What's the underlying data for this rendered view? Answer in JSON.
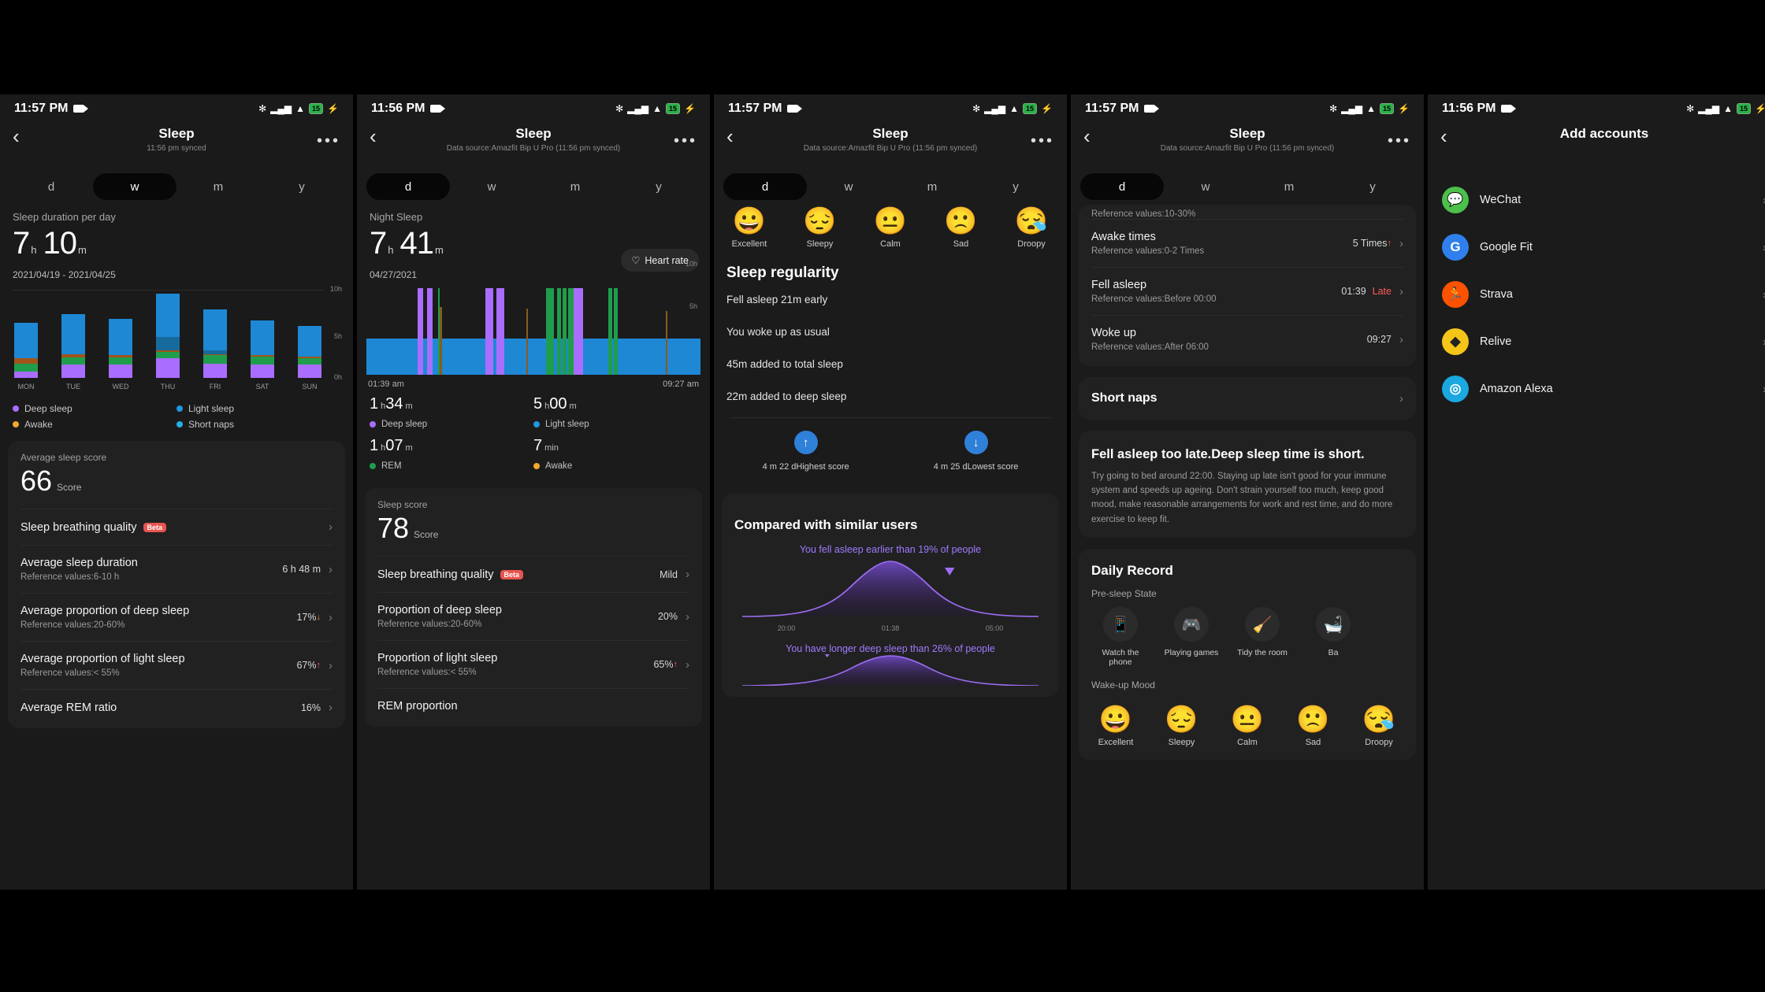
{
  "panels": {
    "p1": {
      "status": {
        "time": "11:57 PM",
        "battery": "15"
      },
      "header": {
        "title": "Sleep",
        "subtitle": "11:56 pm synced",
        "back": "‹",
        "menu": "•••"
      },
      "tabs": [
        {
          "label": "d",
          "active": false
        },
        {
          "label": "w",
          "active": true
        },
        {
          "label": "m",
          "active": false
        },
        {
          "label": "y",
          "active": false
        }
      ],
      "section_label": "Sleep duration per day",
      "value": {
        "hours": "7",
        "h_unit": "h",
        "minutes": "10",
        "m_unit": "m"
      },
      "range": "2021/04/19 - 2021/04/25",
      "y_ticks": [
        "10h",
        "5h",
        "0h"
      ],
      "legend": [
        {
          "label": "Deep sleep",
          "color": "#a96dff"
        },
        {
          "label": "Light sleep",
          "color": "#2196e3"
        },
        {
          "label": "Awake",
          "color": "#f0a92e"
        },
        {
          "label": "Short naps",
          "color": "#23b0e8"
        }
      ],
      "avg_score_label": "Average sleep score",
      "avg_score": "66",
      "score_unit": "Score",
      "rows": [
        {
          "title": "Sleep breathing quality",
          "badge": "Beta",
          "sub": "",
          "value": "",
          "arrow": ""
        },
        {
          "title": "Average sleep duration",
          "sub": "Reference values:6-10 h",
          "value": "6 h 48 m",
          "arrow": ""
        },
        {
          "title": "Average proportion of deep sleep",
          "sub": "Reference values:20-60%",
          "value": "17%",
          "arrow": "↓",
          "arrow_color": "#ff8a3d"
        },
        {
          "title": "Average proportion of light sleep",
          "sub": "Reference values:< 55%",
          "value": "67%",
          "arrow": "↑",
          "arrow_color": "#ff5a5a"
        },
        {
          "title": "Average REM ratio",
          "sub": "",
          "value": "16%",
          "arrow": "↑",
          "arrow_color": "#ff5a5a"
        }
      ]
    },
    "p2": {
      "status": {
        "time": "11:56 PM",
        "battery": "15"
      },
      "header": {
        "title": "Sleep",
        "subtitle": "Data source:Amazfit Bip U Pro (11:56 pm synced)",
        "back": "‹",
        "menu": "•••"
      },
      "tabs": [
        {
          "label": "d",
          "active": true
        },
        {
          "label": "w",
          "active": false
        },
        {
          "label": "m",
          "active": false
        },
        {
          "label": "y",
          "active": false
        }
      ],
      "section_label": "Night Sleep",
      "value": {
        "hours": "7",
        "h_unit": "h",
        "minutes": "41",
        "m_unit": "m"
      },
      "date": "04/27/2021",
      "heart_rate_btn": "Heart rate",
      "y_ticks": [
        "10h",
        "5h"
      ],
      "start_time": "01:39 am",
      "end_time": "09:27 am",
      "stats": [
        {
          "value": "1",
          "unit1": "h",
          "value2": "34",
          "unit2": "m",
          "label": "Deep sleep",
          "color": "#a96dff"
        },
        {
          "value": "5",
          "unit1": "h",
          "value2": "00",
          "unit2": "m",
          "label": "Light sleep",
          "color": "#2196e3"
        },
        {
          "value": "1",
          "unit1": "h",
          "value2": "07",
          "unit2": "m",
          "label": "REM",
          "color": "#1f9d4d"
        },
        {
          "value": "7",
          "unit1": "",
          "value2": "",
          "unit2": "min",
          "label": "Awake",
          "color": "#f0a92e"
        }
      ],
      "score_label": "Sleep score",
      "score": "78",
      "score_unit": "Score",
      "rows": [
        {
          "title": "Sleep breathing quality",
          "badge": "Beta",
          "sub": "",
          "value": "Mild"
        },
        {
          "title": "Proportion of deep sleep",
          "sub": "Reference values:20-60%",
          "value": "20%"
        },
        {
          "title": "Proportion of light sleep",
          "sub": "Reference values:< 55%",
          "value": "65%",
          "arrow": "↑",
          "arrow_color": "#ff5a5a"
        },
        {
          "title": "REM proportion",
          "sub": "",
          "value": ""
        }
      ]
    },
    "p3": {
      "status": {
        "time": "11:57 PM",
        "battery": "15"
      },
      "header": {
        "title": "Sleep",
        "subtitle": "Data source:Amazfit Bip U Pro (11:56 pm synced)",
        "back": "‹",
        "menu": "•••"
      },
      "tabs": [
        {
          "label": "d",
          "active": true
        },
        {
          "label": "w",
          "active": false
        },
        {
          "label": "m",
          "active": false
        },
        {
          "label": "y",
          "active": false
        }
      ],
      "moods": [
        {
          "emoji": "😀",
          "label": "Excellent"
        },
        {
          "emoji": "😔",
          "label": "Sleepy"
        },
        {
          "emoji": "😐",
          "label": "Calm"
        },
        {
          "emoji": "🙁",
          "label": "Sad"
        },
        {
          "emoji": "😪",
          "label": "Droopy"
        }
      ],
      "regularity_title": "Sleep regularity",
      "regularity_items": [
        "Fell asleep 21m early",
        "You woke up as usual",
        "45m added to total sleep",
        "22m added to deep sleep"
      ],
      "score_pair": [
        {
          "icon": "↑",
          "text": "4 m 22 dHighest score",
          "color": "#2f80d8"
        },
        {
          "icon": "↓",
          "text": "4 m 25 dLowest score",
          "color": "#2f80d8"
        }
      ],
      "compare_title": "Compared with similar users",
      "compare_items": [
        {
          "text": "You fell asleep earlier than 19% of people",
          "axis": [
            "20:00",
            "01:38",
            "05:00"
          ]
        },
        {
          "text": "You have longer deep sleep than 26% of people",
          "axis": []
        }
      ]
    },
    "p4": {
      "status": {
        "time": "11:57 PM",
        "battery": "15"
      },
      "header": {
        "title": "Sleep",
        "subtitle": "Data source:Amazfit Bip U Pro (11:56 pm synced)",
        "back": "‹",
        "menu": "•••"
      },
      "tabs": [
        {
          "label": "d",
          "active": true
        },
        {
          "label": "w",
          "active": false
        },
        {
          "label": "m",
          "active": false
        },
        {
          "label": "y",
          "active": false
        }
      ],
      "cut_row": "Reference values:10-30%",
      "rows": [
        {
          "title": "Awake times",
          "sub": "Reference values:0-2 Times",
          "value": "5 Times",
          "arrow": "↑",
          "arrow_color": "#ff5a5a"
        },
        {
          "title": "Fell asleep",
          "sub": "Reference values:Before 00:00",
          "value": "01:39",
          "tag": "Late"
        },
        {
          "title": "Woke up",
          "sub": "Reference values:After 06:00",
          "value": "09:27"
        }
      ],
      "short_naps": "Short naps",
      "advice_title": "Fell asleep too late.Deep sleep time is short.",
      "advice_body": "Try going to bed around 22:00. Staying up late isn't good for your immune system and speeds up ageing. Don't strain yourself too much, keep good mood, make reasonable arrangements for work and rest time, and do more exercise to keep fit.",
      "daily_record": "Daily Record",
      "presleep_label": "Pre-sleep State",
      "activities": [
        {
          "icon": "📱",
          "label": "Watch the phone"
        },
        {
          "icon": "🎮",
          "label": "Playing games"
        },
        {
          "icon": "🧹",
          "label": "Tidy the room"
        },
        {
          "icon": "🛁",
          "label": "Ba"
        }
      ],
      "wake_mood_label": "Wake-up Mood",
      "moods": [
        {
          "emoji": "😀",
          "label": "Excellent"
        },
        {
          "emoji": "😔",
          "label": "Sleepy"
        },
        {
          "emoji": "😐",
          "label": "Calm"
        },
        {
          "emoji": "🙁",
          "label": "Sad"
        },
        {
          "emoji": "😪",
          "label": "Droopy"
        }
      ]
    },
    "p5": {
      "status": {
        "time": "11:56 PM",
        "battery": "15"
      },
      "title": "Add accounts",
      "back": "‹",
      "accounts": [
        {
          "name": "WeChat",
          "glyph": "💬",
          "color": "#4bc14b"
        },
        {
          "name": "Google Fit",
          "glyph": "G",
          "color": "#2f80ed"
        },
        {
          "name": "Strava",
          "glyph": "🏃",
          "color": "#fc5200"
        },
        {
          "name": "Relive",
          "glyph": "◆",
          "color": "#f5c518"
        },
        {
          "name": "Amazon Alexa",
          "glyph": "◎",
          "color": "#1ba7e0"
        }
      ],
      "chevron": "›"
    }
  },
  "chart_data": [
    {
      "type": "bar",
      "title": "Sleep duration per day",
      "subtitle": "2021/04/19 - 2021/04/25",
      "categories": [
        "MON",
        "TUE",
        "WED",
        "THU",
        "FRI",
        "SAT",
        "SUN"
      ],
      "ylabel": "",
      "ylim": [
        0,
        10
      ],
      "yticks": [
        "0h",
        "5h",
        "10h"
      ],
      "stacked": true,
      "series": [
        {
          "name": "Deep sleep",
          "color": "#a96dff",
          "values": [
            0.75,
            1.5,
            1.5,
            2.2,
            1.6,
            1.5,
            1.5
          ]
        },
        {
          "name": "REM",
          "color": "#1f9d4d",
          "values": [
            0.9,
            0.8,
            0.8,
            0.75,
            0.95,
            0.9,
            0.7
          ]
        },
        {
          "name": "Awake",
          "color": "#a0541a",
          "values": [
            0.6,
            0.35,
            0.3,
            0.2,
            0.15,
            0.2,
            0.2
          ]
        },
        {
          "name": "Short naps",
          "color": "#176a9c",
          "values": [
            0,
            0,
            0,
            1.5,
            0.45,
            0,
            0
          ]
        },
        {
          "name": "Light sleep",
          "color": "#1e88d4",
          "values": [
            4.0,
            4.6,
            4.1,
            4.9,
            4.6,
            3.9,
            3.5
          ]
        }
      ]
    },
    {
      "type": "bar",
      "title": "Night Sleep",
      "subtitle": "04/27/2021",
      "xlabels": [
        "01:39 am",
        "09:27 am"
      ],
      "yticks": [
        "5h",
        "10h"
      ],
      "legend": [
        "Deep sleep",
        "Light sleep",
        "REM",
        "Awake"
      ],
      "totals": {
        "deep": "1 h 34 m",
        "light": "5 h 00 m",
        "rem": "1 h 07 m",
        "awake": "7 min"
      }
    },
    {
      "type": "area",
      "title": "You fell asleep earlier than 19% of people",
      "xlabels": [
        "20:00",
        "01:38",
        "05:00"
      ],
      "marker_percent": 19
    },
    {
      "type": "area",
      "title": "You have longer deep sleep than 26% of people",
      "marker_percent": 26
    }
  ]
}
